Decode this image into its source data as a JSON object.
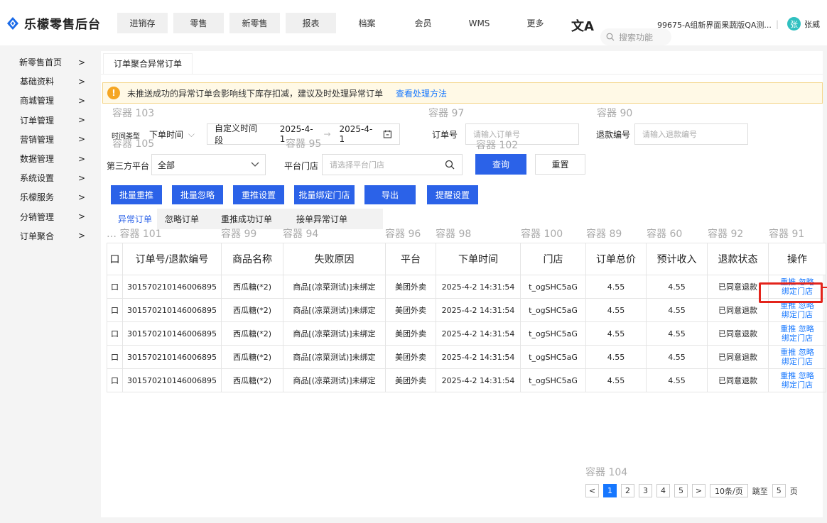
{
  "brand": {
    "name": "乐檬零售后台",
    "logo_icon": "diamond-logo-icon",
    "logo_color": "#1b6be8"
  },
  "nav": [
    "进销存",
    "零售",
    "新零售",
    "报表",
    "档案",
    "会员",
    "WMS",
    "更多"
  ],
  "translate_icon": "文A",
  "search_func_placeholder": "搜索功能",
  "tenant": "99675-A组新界面果蔬版QA测...",
  "separator": "|",
  "user": {
    "avatar_text": "张",
    "name": "张威",
    "avatar_color": "#30c0c0"
  },
  "sidebar": [
    {
      "label": "新零售首页",
      "arrow": ">"
    },
    {
      "label": "基础资料",
      "arrow": ">"
    },
    {
      "label": "商城管理",
      "arrow": ">"
    },
    {
      "label": "订单管理",
      "arrow": ">"
    },
    {
      "label": "营销管理",
      "arrow": ">"
    },
    {
      "label": "数据管理",
      "arrow": ">"
    },
    {
      "label": "系统设置",
      "arrow": ">"
    },
    {
      "label": "乐檬服务",
      "arrow": ">"
    },
    {
      "label": "分销管理",
      "arrow": ">"
    },
    {
      "label": "订单聚合",
      "arrow": ">"
    }
  ],
  "page_tab": "订单聚合异常订单",
  "alert": {
    "icon": "!",
    "text": "未推送成功的异常订单会影响线下库存扣减，建议及时处理异常订单",
    "link": "查看处理方法"
  },
  "containers": {
    "c103": "容器 103",
    "c97": "容器 97",
    "c90": "容器 90",
    "c105": "容器 105",
    "c95": "容器 95",
    "c102": "容器 102",
    "c101": "… 容器 101",
    "c99": "容器 99",
    "c94": "容器 94",
    "c96": "容器 96",
    "c98": "容器 98",
    "c100": "容器 100",
    "c89": "容器 89",
    "c60": "容器 60",
    "c92": "容器 92",
    "c91": "容器 91",
    "c104": "容器 104"
  },
  "filters": {
    "time_type_label": "时间类型",
    "time_type_value": "下单时间",
    "time_type_caret": "⌵",
    "custom_range_label": "自定义时间段",
    "date_start": "2025-4-1",
    "date_arrow": "→",
    "date_end": "2025-4-1",
    "order_no_label": "订单号",
    "order_no_placeholder": "请输入订单号",
    "refund_no_label": "退款编号",
    "refund_no_placeholder": "请输入退款编号",
    "platform_label": "第三方平台",
    "platform_value": "全部",
    "store_label": "平台门店",
    "store_placeholder": "请选择平台门店"
  },
  "buttons": {
    "query": "查询",
    "reset": "重置",
    "batch_repush": "批量重推",
    "batch_ignore": "批量忽略",
    "repush_settings": "重推设置",
    "batch_bind_store": "批量绑定门店",
    "export": "导出",
    "reminder_settings": "提醒设置"
  },
  "subtabs": [
    "异常订单",
    "忽略订单",
    "重推成功订单",
    "接单异常订单"
  ],
  "table": {
    "checkbox_glyph": "口",
    "columns": [
      "订单号/退款编号",
      "商品名称",
      "失败原因",
      "平台",
      "下单时间",
      "门店",
      "订单总价",
      "预计收入",
      "退款状态",
      "操作"
    ],
    "rows": [
      {
        "order_no": "301570210146006895",
        "product": "西瓜糖(*2)",
        "reason": "商品[(凉菜测试)]未绑定",
        "platform": "美团外卖",
        "time": "2025-4-2 14:31:54",
        "store": "t_ogSHC5aG",
        "total": "4.55",
        "income": "4.55",
        "refund_status": "已同意退款"
      },
      {
        "order_no": "301570210146006895",
        "product": "西瓜糖(*2)",
        "reason": "商品[(凉菜测试)]未绑定",
        "platform": "美团外卖",
        "time": "2025-4-2 14:31:54",
        "store": "t_ogSHC5aG",
        "total": "4.55",
        "income": "4.55",
        "refund_status": "已同意退款"
      },
      {
        "order_no": "301570210146006895",
        "product": "西瓜糖(*2)",
        "reason": "商品[(凉菜测试)]未绑定",
        "platform": "美团外卖",
        "time": "2025-4-2 14:31:54",
        "store": "t_ogSHC5aG",
        "total": "4.55",
        "income": "4.55",
        "refund_status": "已同意退款"
      },
      {
        "order_no": "301570210146006895",
        "product": "西瓜糖(*2)",
        "reason": "商品[(凉菜测试)]未绑定",
        "platform": "美团外卖",
        "time": "2025-4-2 14:31:54",
        "store": "t_ogSHC5aG",
        "total": "4.55",
        "income": "4.55",
        "refund_status": "已同意退款"
      },
      {
        "order_no": "301570210146006895",
        "product": "西瓜糖(*2)",
        "reason": "商品[(凉菜测试)]未绑定",
        "platform": "美团外卖",
        "time": "2025-4-2 14:31:54",
        "store": "t_ogSHC5aG",
        "total": "4.55",
        "income": "4.55",
        "refund_status": "已同意退款"
      }
    ],
    "op_repush": "重推",
    "op_ignore": "忽略",
    "op_bind": "绑定门店"
  },
  "pagination": {
    "prev": "<",
    "pages": [
      "1",
      "2",
      "3",
      "4",
      "5"
    ],
    "current": "1",
    "next": ">",
    "page_size": "10条/页",
    "jump_label": "跳至",
    "jump_value": "5",
    "page_unit": "页"
  },
  "colors": {
    "primary": "#2b62e8",
    "link": "#1677ff",
    "alert_bg": "#fff9e6",
    "highlight": "#e3241b"
  }
}
